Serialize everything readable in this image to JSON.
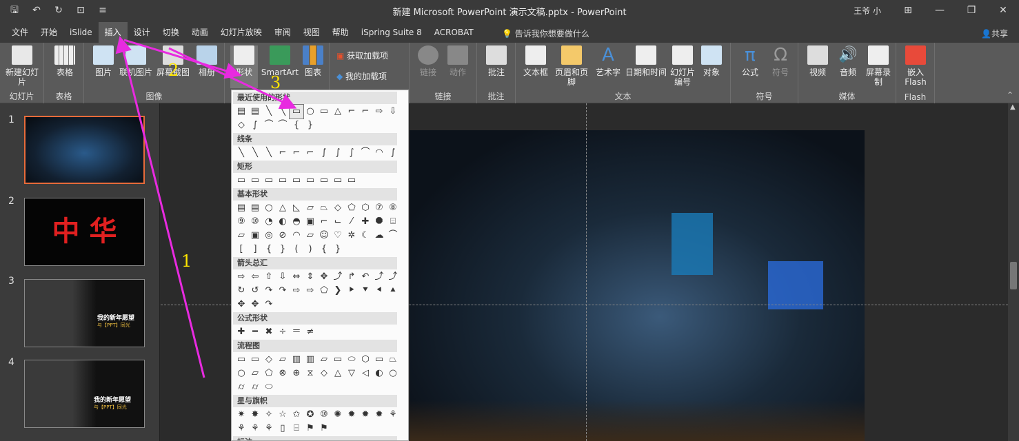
{
  "titlebar": {
    "title": "新建 Microsoft PowerPoint 演示文稿.pptx - PowerPoint",
    "user": "王爷 小",
    "qat_icons": [
      "save-icon",
      "undo-icon",
      "redo-icon",
      "presenter-icon",
      "customize-icon"
    ]
  },
  "menubar": {
    "tabs": [
      "文件",
      "开始",
      "iSlide",
      "插入",
      "设计",
      "切换",
      "动画",
      "幻灯片放映",
      "审阅",
      "视图",
      "帮助",
      "iSpring Suite 8",
      "ACROBAT"
    ],
    "active_tab": "插入",
    "tellme": "告诉我你想要做什么",
    "share": "共享"
  },
  "ribbon": {
    "groups": {
      "slides": "幻灯片",
      "tables": "表格",
      "images": "图像",
      "addins": "",
      "links": "链接",
      "comments": "批注",
      "text": "文本",
      "symbols": "符号",
      "media": "媒体",
      "flash": "Flash"
    },
    "buttons": {
      "new_slide": "新建幻灯片",
      "table": "表格",
      "picture": "图片",
      "online_picture": "联机图片",
      "screenshot": "屏幕截图",
      "album": "相册",
      "shapes": "形状",
      "smartart": "SmartArt",
      "chart": "图表",
      "get_addins": "获取加载项",
      "my_addins": "我的加载项",
      "link": "链接",
      "action": "动作",
      "comment": "批注",
      "textbox": "文本框",
      "header_footer": "页眉和页脚",
      "wordart": "艺术字",
      "datetime": "日期和时间",
      "slide_number": "幻灯片编号",
      "object": "对象",
      "equation": "公式",
      "symbol": "符号",
      "video": "视频",
      "audio": "音频",
      "screen_record": "屏幕录制",
      "embed_flash": "嵌入Flash"
    }
  },
  "slides": [
    {
      "num": "1"
    },
    {
      "num": "2",
      "text": "中 华"
    },
    {
      "num": "3",
      "text": "我的新年愿望",
      "sub": "与【PPT】同光"
    },
    {
      "num": "4",
      "text": "我的新年愿望",
      "sub": "与【PPT】同光"
    }
  ],
  "shapes_menu": {
    "sections": [
      "最近使用的形状",
      "线条",
      "矩形",
      "基本形状",
      "箭头总汇",
      "公式形状",
      "流程图",
      "星与旗帜",
      "标注"
    ],
    "recent": [
      "▤",
      "▤",
      "╲",
      "╲",
      "▭",
      "○",
      "▭",
      "△",
      "⌐",
      "⌐",
      "⇨",
      "⇩",
      "◇",
      "∫",
      "⌒",
      "⌒",
      "{",
      "}"
    ],
    "lines": [
      "╲",
      "╲",
      "╲",
      "⌐",
      "⌐",
      "⌐",
      "∫",
      "∫",
      "∫",
      "⌒",
      "◠",
      "∫"
    ],
    "rects": [
      "▭",
      "▭",
      "▭",
      "▭",
      "▭",
      "▭",
      "▭",
      "▭",
      "▭"
    ],
    "basic": [
      "▤",
      "▤",
      "○",
      "△",
      "◺",
      "▱",
      "⏢",
      "◇",
      "⬠",
      "⬡",
      "⑦",
      "⑧",
      "⑨",
      "⑩",
      "◔",
      "◐",
      "◓",
      "▣",
      "⌐",
      "⌙",
      "⁄",
      "✚",
      "⯃",
      "⌸",
      "▱",
      "▣",
      "◎",
      "⊘",
      "◠",
      "▱",
      "☺",
      "♡",
      "✲",
      "☾",
      "☁",
      "⌒",
      "[",
      "]",
      "{",
      "}",
      "(",
      ")",
      "{",
      "}"
    ],
    "arrows": [
      "⇨",
      "⇦",
      "⇧",
      "⇩",
      "⇔",
      "⇕",
      "✥",
      "⤴",
      "↱",
      "↶",
      "⤴",
      "⤴",
      "↻",
      "↺",
      "↷",
      "↷",
      "⇨",
      "⇨",
      "⬠",
      "❯",
      "⯈",
      "⯆",
      "⯇",
      "⯅",
      "✥",
      "✥",
      "↷"
    ],
    "equations": [
      "✚",
      "━",
      "✖",
      "÷",
      "＝",
      "≠"
    ],
    "flowchart": [
      "▭",
      "▭",
      "◇",
      "▱",
      "▥",
      "▥",
      "▱",
      "▭",
      "⬭",
      "⬡",
      "▭",
      "⏢",
      "○",
      "▱",
      "⬠",
      "⊗",
      "⊕",
      "⧖",
      "◇",
      "△",
      "▽",
      "◁",
      "◐",
      "○",
      "⌭",
      "⌭",
      "⬭"
    ],
    "stars": [
      "✷",
      "✸",
      "✧",
      "☆",
      "✩",
      "✪",
      "⑩",
      "✺",
      "✹",
      "✹",
      "✹",
      "⚘",
      "⚘",
      "⚘",
      "⚘",
      "▯",
      "⌸",
      "⚑",
      "⚑"
    ]
  },
  "annotations": [
    "1",
    "2",
    "3"
  ]
}
